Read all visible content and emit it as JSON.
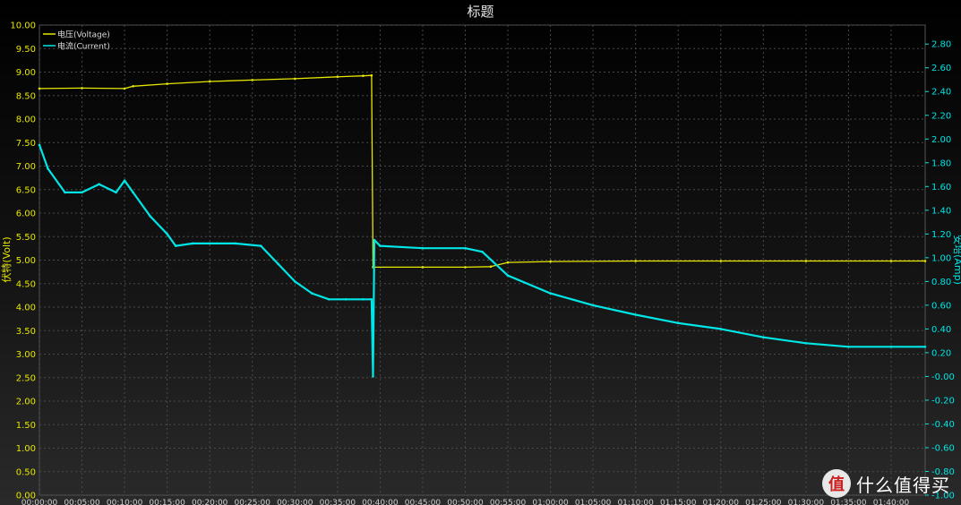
{
  "chart_data": {
    "type": "line",
    "title": "标题",
    "xlabel": "",
    "ylabel": "伏特(Volt)",
    "y2label": "安培(Amp)",
    "x_ticks": [
      "00:00:00",
      "00:05:00",
      "00:10:00",
      "00:15:00",
      "00:20:00",
      "00:25:00",
      "00:30:00",
      "00:35:00",
      "00:40:00",
      "00:45:00",
      "00:50:00",
      "00:55:00",
      "01:00:00",
      "01:05:00",
      "01:10:00",
      "01:15:00",
      "01:20:00",
      "01:25:00",
      "01:30:00",
      "01:35:00",
      "01:40:00"
    ],
    "xlim": [
      "00:00:00",
      "01:44:00"
    ],
    "ylim": [
      0,
      10
    ],
    "y_ticks": [
      "0.00",
      "0.50",
      "1.00",
      "1.50",
      "2.00",
      "2.50",
      "3.00",
      "3.50",
      "4.00",
      "4.50",
      "5.00",
      "5.50",
      "6.00",
      "6.50",
      "7.00",
      "7.50",
      "8.00",
      "8.50",
      "9.00",
      "9.50",
      "10.00"
    ],
    "y2lim": [
      -1.0,
      2.96
    ],
    "y2_ticks": [
      "-1.00",
      "-0.80",
      "-0.60",
      "-0.40",
      "-0.20",
      "-0.00",
      "0.20",
      "0.40",
      "0.60",
      "0.80",
      "1.00",
      "1.20",
      "1.40",
      "1.60",
      "1.80",
      "2.00",
      "2.20",
      "2.40",
      "2.60",
      "2.80"
    ],
    "grid": true,
    "legend": "top-left",
    "series": [
      {
        "name": "电压(Voltage)",
        "axis": "left",
        "color": "#e6e600",
        "x": [
          "00:00:00",
          "00:05:00",
          "00:10:00",
          "00:11:00",
          "00:15:00",
          "00:20:00",
          "00:25:00",
          "00:30:00",
          "00:35:00",
          "00:38:00",
          "00:39:00",
          "00:39:10",
          "00:45:00",
          "00:50:00",
          "00:53:00",
          "00:55:00",
          "01:00:00",
          "01:10:00",
          "01:20:00",
          "01:30:00",
          "01:40:00",
          "01:44:00"
        ],
        "values": [
          8.65,
          8.66,
          8.65,
          8.7,
          8.75,
          8.8,
          8.83,
          8.86,
          8.9,
          8.92,
          8.93,
          4.85,
          4.85,
          4.85,
          4.86,
          4.95,
          4.97,
          4.98,
          4.98,
          4.98,
          4.98,
          4.98
        ]
      },
      {
        "name": "电流(Current)",
        "axis": "right",
        "color": "#00e5e5",
        "x": [
          "00:00:00",
          "00:01:00",
          "00:03:00",
          "00:05:00",
          "00:07:00",
          "00:09:00",
          "00:10:00",
          "00:11:00",
          "00:13:00",
          "00:15:00",
          "00:16:00",
          "00:18:00",
          "00:20:00",
          "00:23:00",
          "00:26:00",
          "00:28:00",
          "00:30:00",
          "00:32:00",
          "00:34:00",
          "00:36:00",
          "00:38:00",
          "00:39:00",
          "00:39:10",
          "00:39:20",
          "00:40:00",
          "00:45:00",
          "00:50:00",
          "00:52:00",
          "00:55:00",
          "01:00:00",
          "01:05:00",
          "01:10:00",
          "01:15:00",
          "01:20:00",
          "01:25:00",
          "01:30:00",
          "01:35:00",
          "01:40:00",
          "01:44:00"
        ],
        "values": [
          1.95,
          1.75,
          1.55,
          1.55,
          1.62,
          1.55,
          1.65,
          1.55,
          1.35,
          1.2,
          1.1,
          1.12,
          1.12,
          1.12,
          1.1,
          0.95,
          0.8,
          0.7,
          0.65,
          0.65,
          0.65,
          0.65,
          0.0,
          1.15,
          1.1,
          1.08,
          1.08,
          1.05,
          0.85,
          0.7,
          0.6,
          0.52,
          0.45,
          0.4,
          0.33,
          0.28,
          0.25,
          0.25,
          0.25
        ]
      }
    ]
  },
  "watermark": {
    "text": "什么值得买",
    "logo_glyph": "值"
  }
}
